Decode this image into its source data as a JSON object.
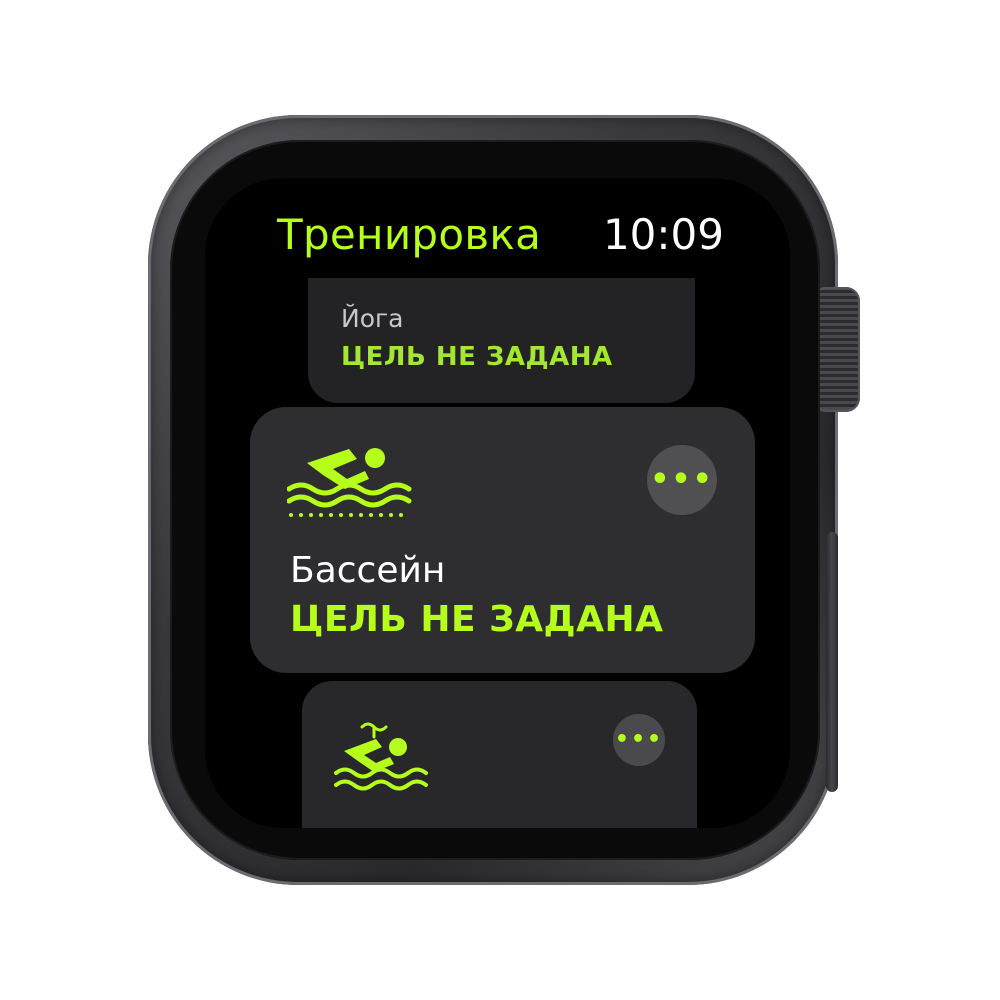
{
  "header": {
    "app_title": "Тренировка",
    "time": "10:09"
  },
  "workouts": [
    {
      "name": "Йога",
      "goal": "ЦЕЛЬ НЕ ЗАДАНА",
      "icon": "yoga-icon"
    },
    {
      "name": "Бассейн",
      "goal": "ЦЕЛЬ НЕ ЗАДАНА",
      "icon": "pool-swim-icon",
      "more_label": "•••"
    },
    {
      "icon": "open-water-swim-icon",
      "more_label": "•••"
    }
  ],
  "colors": {
    "accent": "#b6ff1c",
    "card": "#2e2e30",
    "screen": "#000000",
    "case": "#3a3a3d"
  }
}
